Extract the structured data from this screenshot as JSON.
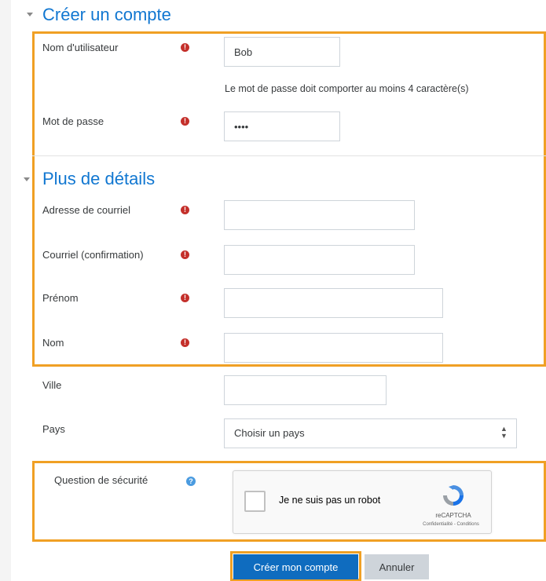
{
  "section_account": {
    "title": "Créer un compte",
    "username_label": "Nom d'utilisateur",
    "username_value": "Bob",
    "password_hint": "Le mot de passe doit comporter au moins 4 caractère(s)",
    "password_label": "Mot de passe",
    "password_value": "••••"
  },
  "section_details": {
    "title": "Plus de détails",
    "email_label": "Adresse de courriel",
    "email_value": "",
    "email_confirm_label": "Courriel (confirmation)",
    "email_confirm_value": "",
    "firstname_label": "Prénom",
    "firstname_value": "",
    "lastname_label": "Nom",
    "lastname_value": "",
    "city_label": "Ville",
    "city_value": "",
    "country_label": "Pays",
    "country_selected": "Choisir un pays"
  },
  "security": {
    "label": "Question de sécurité",
    "captcha_text": "Je ne suis pas un robot",
    "captcha_brand": "reCAPTCHA",
    "captcha_links": "Confidentialité - Conditions"
  },
  "actions": {
    "submit": "Créer mon compte",
    "cancel": "Annuler"
  },
  "icons": {
    "required": "!",
    "help": "?"
  },
  "colors": {
    "accent_blue": "#1177d1",
    "highlight_orange": "#f0a024",
    "required_red": "#c4302b",
    "primary_button": "#0f6cbf"
  }
}
